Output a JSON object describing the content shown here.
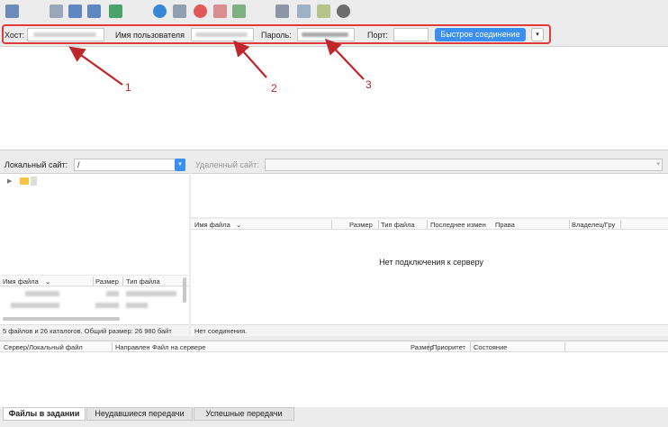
{
  "quickconnect": {
    "host_label": "Хост:",
    "user_label": "Имя пользователя",
    "pass_label": "Пароль:",
    "port_label": "Порт:",
    "button_label": "Быстрое соединение",
    "dropdown_glyph": "▾"
  },
  "annotations": [
    "1",
    "2",
    "3"
  ],
  "local": {
    "label": "Локальный сайт:",
    "path": "/",
    "columns": [
      "Имя файла",
      "Размер",
      "Тип файла"
    ],
    "status": "5 файлов и 26 каталогов. Общий размер: 26 980 байт"
  },
  "remote": {
    "label": "Удаленный сайт:",
    "columns": [
      "Имя файла",
      "Размер",
      "Тип файла",
      "Последнее измен",
      "Права",
      "Владелец/Гру"
    ],
    "empty_message": "Нет подключения к серверу",
    "status": "Нет соединения."
  },
  "queue": {
    "columns": [
      "Сервер/Локальный файл",
      "Направлен",
      "Файл на сервере",
      "Размер",
      "Приоритет",
      "Состояние"
    ],
    "tabs": [
      "Файлы в задании",
      "Неудавшиеся передачи",
      "Успешные передачи"
    ]
  },
  "colors": {
    "accent": "#3b8ff0",
    "annotation": "#c0272d",
    "folder": "#f5c442"
  },
  "icons": [
    "site-manager-icon",
    "message-log-icon",
    "local-tree-icon",
    "remote-tree-icon",
    "transfer-queue-icon",
    "refresh-icon",
    "process-queue-icon",
    "cancel-icon",
    "disconnect-icon",
    "reconnect-icon",
    "filter-icon",
    "toggle-compare-icon",
    "sync-browse-icon",
    "search-icon"
  ]
}
